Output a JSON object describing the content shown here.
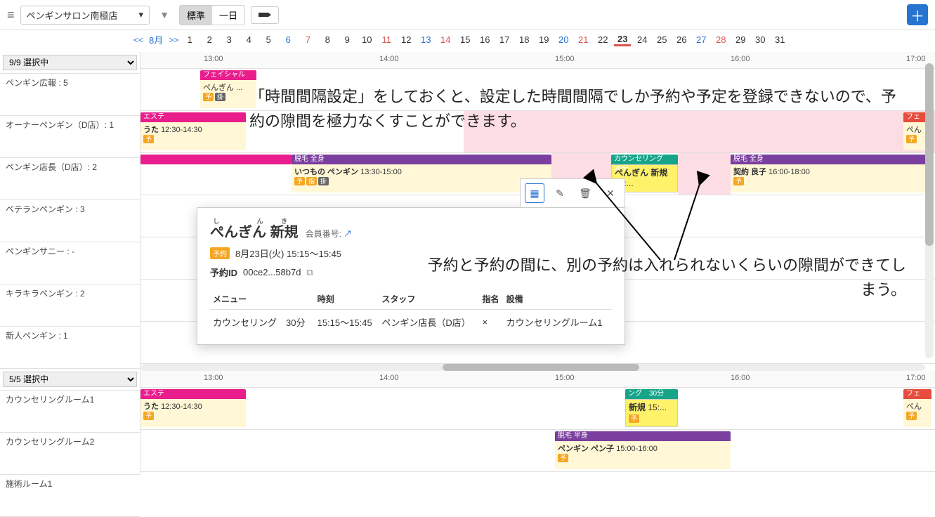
{
  "topbar": {
    "store": "ペンギンサロン南極店",
    "view_std": "標準",
    "view_day": "一日"
  },
  "dates": {
    "prev": "<<",
    "month": "8月",
    "next": ">>",
    "days": [
      {
        "n": "1"
      },
      {
        "n": "2"
      },
      {
        "n": "3"
      },
      {
        "n": "4"
      },
      {
        "n": "5"
      },
      {
        "n": "6",
        "cls": "sat"
      },
      {
        "n": "7",
        "cls": "sun"
      },
      {
        "n": "8"
      },
      {
        "n": "9"
      },
      {
        "n": "10"
      },
      {
        "n": "11",
        "cls": "sun"
      },
      {
        "n": "12"
      },
      {
        "n": "13",
        "cls": "sat"
      },
      {
        "n": "14",
        "cls": "sun"
      },
      {
        "n": "15"
      },
      {
        "n": "16"
      },
      {
        "n": "17"
      },
      {
        "n": "18"
      },
      {
        "n": "19"
      },
      {
        "n": "20",
        "cls": "sat"
      },
      {
        "n": "21",
        "cls": "sun"
      },
      {
        "n": "22"
      },
      {
        "n": "23",
        "cls": "today"
      },
      {
        "n": "24"
      },
      {
        "n": "25"
      },
      {
        "n": "26"
      },
      {
        "n": "27",
        "cls": "sat"
      },
      {
        "n": "28",
        "cls": "sun"
      },
      {
        "n": "29"
      },
      {
        "n": "30"
      },
      {
        "n": "31"
      }
    ]
  },
  "sel1": "9/9 選択中",
  "sel2": "5/5 選択中",
  "staff": [
    "ペンギン広報 : 5",
    "オーナーペンギン（D店）: 1",
    "ペンギン店長（D店）: 2",
    "ベテランペンギン : 3",
    "ペンギンサニー : -",
    "キラキラペンギン : 2",
    "新人ペンギン : 1"
  ],
  "rooms": [
    "カウンセリングルーム1",
    "カウンセリングルーム2",
    "施術ルーム1"
  ],
  "times": {
    "t13": "13:00",
    "t14": "14:00",
    "t15": "15:00",
    "t16": "16:00",
    "t17": "17:00"
  },
  "ev": {
    "facial": "フェイシャル",
    "pengin_child": "ぺんぎん ...",
    "este": "エステ",
    "uta": "うた",
    "uta_time": "12:30-14:30",
    "datsu_zen": "脱毛 全身",
    "itsumo": "いつもの ペンギン",
    "itsumo_time": "13:30-15:00",
    "counsel": "カウンセリング　30分",
    "shinki": "ぺんぎん 新規",
    "shinki_time": "15:...",
    "keiyaku": "契約 良子",
    "keiyaku_time": "16:00-18:00",
    "datsu_han": "脱毛 半身",
    "penko": "ペンギン ペン子",
    "penko_time": "15:00-16:00",
    "ring": "ング　30分",
    "shinki2": "新規",
    "fe": "フェ",
    "pen_partial": "ぺん"
  },
  "tags": {
    "yo": "予",
    "sashi": "指",
    "kake": "掛"
  },
  "ann1": "「時間間隔設定」をしておくと、設定した時間間隔でしか予約や予定を登録できないので、予約の隙間を極力なくすことができます。",
  "ann2": "予約と予約の間に、別の予約は入れられないくらいの隙間ができてしまう。",
  "popup": {
    "name1": "ぺんぎん",
    "rt1": "し",
    "rt2": "ん",
    "name2": "新規",
    "rt3": "き",
    "member_label": "会員番号:",
    "date": "8月23日(火) 15:15～15:45",
    "id_label": "予約ID",
    "id_val": "00ce2...58b7d",
    "h_menu": "メニュー",
    "h_time": "時刻",
    "h_staff": "スタッフ",
    "h_sashi": "指名",
    "h_setsu": "設備",
    "r_menu": "カウンセリング　30分",
    "r_time": "15:15～15:45",
    "r_staff": "ペンギン店長（D店）",
    "r_sashi": "×",
    "r_setsu": "カウンセリングルーム1",
    "badge": "予約"
  }
}
